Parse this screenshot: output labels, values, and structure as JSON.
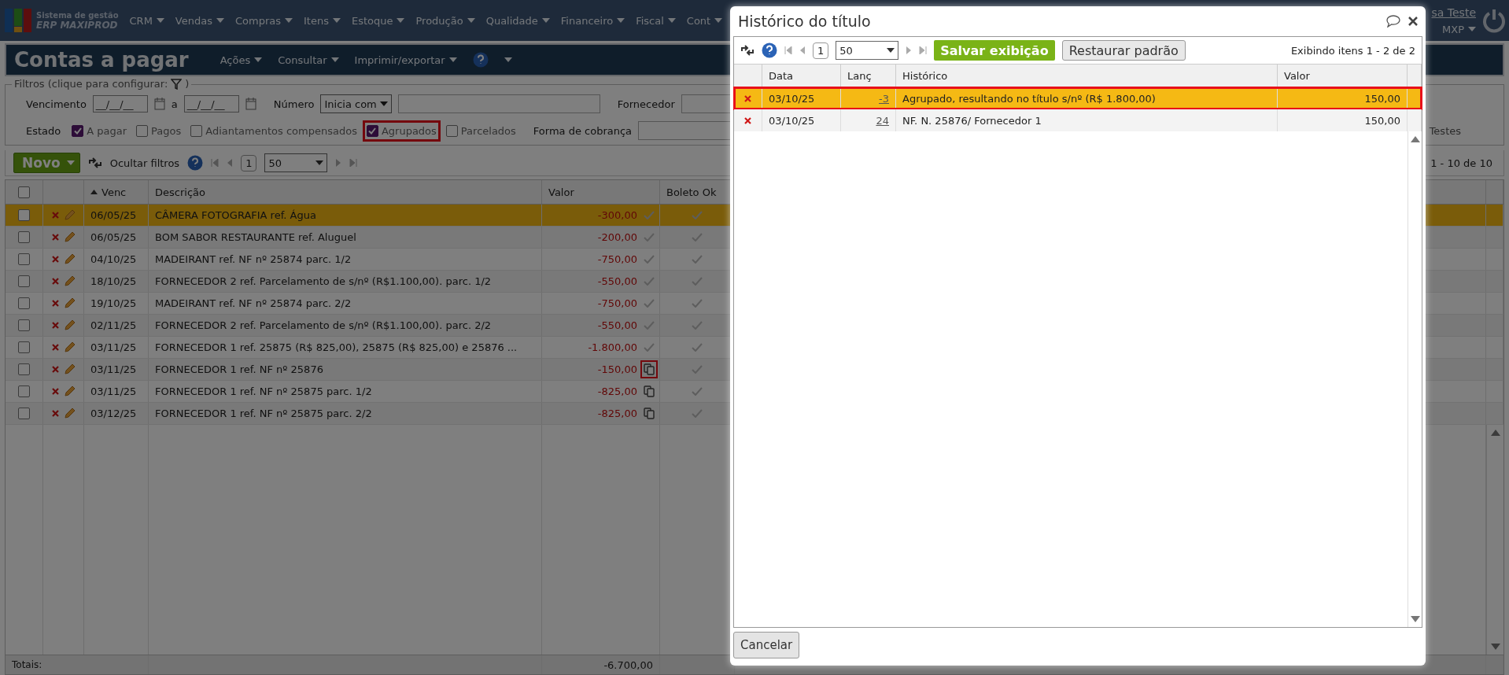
{
  "header": {
    "logo_line1": "Sistema de gestão",
    "logo_line2": "ERP MAXIPROD",
    "menu": [
      "CRM",
      "Vendas",
      "Compras",
      "Itens",
      "Estoque",
      "Produção",
      "Qualidade",
      "Financeiro",
      "Fiscal",
      "Cont"
    ],
    "user": "sa Teste",
    "company": "MXP"
  },
  "page": {
    "title": "Contas a pagar",
    "menu": [
      "Ações",
      "Consultar",
      "Imprimir/exportar"
    ]
  },
  "filters": {
    "legend": "Filtros (clique para configurar:",
    "legend_close": ")",
    "vencimento": "Vencimento",
    "date_from": "__/__/__",
    "between": "a",
    "date_to": "__/__/__",
    "numero": "Número",
    "numero_mode": "Inicia com",
    "fornecedor": "Fornecedor",
    "estado": "Estado",
    "states": [
      {
        "label": "A pagar",
        "checked": true,
        "highlighted": false
      },
      {
        "label": "Pagos",
        "checked": false,
        "highlighted": false
      },
      {
        "label": "Adiantamentos compensados",
        "checked": false,
        "highlighted": false
      },
      {
        "label": "Agrupados",
        "checked": true,
        "highlighted": true
      },
      {
        "label": "Parcelados",
        "checked": false,
        "highlighted": false
      }
    ],
    "forma": "Forma de cobrança",
    "right_label": "Testes"
  },
  "toolbar": {
    "new": "Novo",
    "hide_filters": "Ocultar filtros",
    "page": "1",
    "per_page": "50",
    "range": "1 - 10 de 10"
  },
  "table": {
    "select_all_checked": false,
    "columns": [
      "Venc",
      "Descrição",
      "Valor",
      "Boleto Ok"
    ],
    "rows": [
      {
        "venc": "06/05/25",
        "descricao": "CÂMERA FOTOGRAFIA ref. Água",
        "valor": "-300,00",
        "kind": "check",
        "selected": true,
        "highlighted": false
      },
      {
        "venc": "06/05/25",
        "descricao": "BOM SABOR RESTAURANTE ref. Aluguel",
        "valor": "-200,00",
        "kind": "check",
        "selected": false,
        "highlighted": false
      },
      {
        "venc": "04/10/25",
        "descricao": "MADEIRANT ref. NF nº 25874 parc. 1/2",
        "valor": "-750,00",
        "kind": "check",
        "selected": false,
        "highlighted": false
      },
      {
        "venc": "18/10/25",
        "descricao": "FORNECEDOR 2 ref. Parcelamento de s/nº (R$1.100,00). parc. 1/2",
        "valor": "-550,00",
        "kind": "check",
        "selected": false,
        "highlighted": false
      },
      {
        "venc": "19/10/25",
        "descricao": "MADEIRANT ref. NF nº 25874 parc. 2/2",
        "valor": "-750,00",
        "kind": "check",
        "selected": false,
        "highlighted": false
      },
      {
        "venc": "02/11/25",
        "descricao": "FORNECEDOR 2 ref. Parcelamento de s/nº (R$1.100,00). parc. 2/2",
        "valor": "-550,00",
        "kind": "check",
        "selected": false,
        "highlighted": false
      },
      {
        "venc": "03/11/25",
        "descricao": "FORNECEDOR 1 ref. 25875 (R$ 825,00), 25875 (R$ 825,00) e 25876 ...",
        "valor": "-1.800,00",
        "kind": "check",
        "selected": false,
        "highlighted": false
      },
      {
        "venc": "03/11/25",
        "descricao": "FORNECEDOR 1 ref. NF nº 25876",
        "valor": "-150,00",
        "kind": "copy",
        "selected": false,
        "highlighted": true
      },
      {
        "venc": "03/11/25",
        "descricao": "FORNECEDOR 1 ref. NF nº 25875 parc. 1/2",
        "valor": "-825,00",
        "kind": "copy",
        "selected": false,
        "highlighted": false
      },
      {
        "venc": "03/12/25",
        "descricao": "FORNECEDOR 1 ref. NF nº 25875 parc. 2/2",
        "valor": "-825,00",
        "kind": "copy",
        "selected": false,
        "highlighted": false
      }
    ],
    "totals_label": "Totais:",
    "totals_valor": "-6.700,00"
  },
  "modal": {
    "title": "Histórico do título",
    "page": "1",
    "per_page": "50",
    "save": "Salvar exibição",
    "restore": "Restaurar padrão",
    "range": "Exibindo itens 1 - 2 de 2",
    "columns": [
      "Data",
      "Lanç",
      "Histórico",
      "Valor"
    ],
    "rows": [
      {
        "data": "03/10/25",
        "lanc": "-3",
        "historico": "Agrupado, resultando no título s/nº (R$ 1.800,00)",
        "valor": "150,00",
        "selected": true,
        "highlighted": true
      },
      {
        "data": "03/10/25",
        "lanc": "24",
        "historico": "NF. N. 25876/ Fornecedor 1",
        "valor": "150,00",
        "selected": false,
        "highlighted": false
      }
    ],
    "cancel": "Cancelar"
  }
}
